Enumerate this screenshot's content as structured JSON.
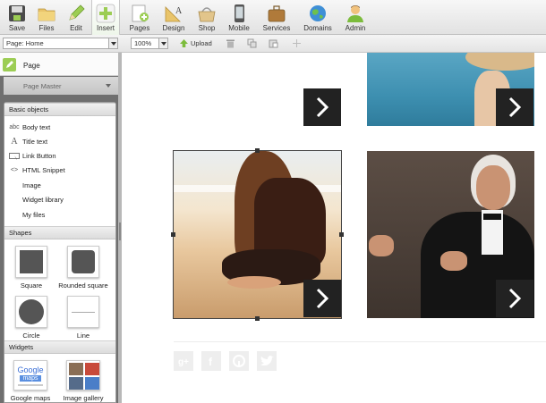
{
  "toolbar": {
    "items": [
      {
        "label": "Save",
        "icon": "save-icon"
      },
      {
        "label": "Files",
        "icon": "folder-icon"
      },
      {
        "label": "Edit",
        "icon": "pencil-icon"
      },
      {
        "label": "Insert",
        "icon": "plus-icon"
      },
      {
        "label": "Pages",
        "icon": "page-add-icon"
      },
      {
        "label": "Design",
        "icon": "design-icon"
      },
      {
        "label": "Shop",
        "icon": "basket-icon"
      },
      {
        "label": "Mobile",
        "icon": "phone-icon"
      },
      {
        "label": "Services",
        "icon": "briefcase-icon"
      },
      {
        "label": "Domains",
        "icon": "globe-icon"
      },
      {
        "label": "Admin",
        "icon": "user-icon"
      }
    ]
  },
  "subbar": {
    "page_select": "Page: Home",
    "zoom_select": "100%",
    "upload_label": "Upload"
  },
  "panel": {
    "page_label": "Page",
    "master_label": "Page Master",
    "basic_title": "Basic objects",
    "basic_items": [
      {
        "icon_text": "abc",
        "label": "Body text"
      },
      {
        "icon_text": "A",
        "label": "Title text"
      },
      {
        "icon_text": "",
        "label": "Link Button"
      },
      {
        "icon_text": "<>",
        "label": "HTML Snippet"
      },
      {
        "icon_text": "",
        "label": "Image"
      },
      {
        "icon_text": "",
        "label": "Widget library"
      },
      {
        "icon_text": "",
        "label": "My files"
      }
    ],
    "shapes_title": "Shapes",
    "shapes": [
      {
        "label": "Square"
      },
      {
        "label": "Rounded square"
      },
      {
        "label": "Circle"
      },
      {
        "label": "Line"
      }
    ],
    "widgets_title": "Widgets",
    "widgets": [
      {
        "label": "Google maps",
        "thumb_text_1": "Google",
        "thumb_text_2": "maps"
      },
      {
        "label": "Image gallery"
      }
    ]
  },
  "colors": {
    "accent_green": "#9ccd54",
    "arrow_bg": "#222222",
    "panel_bg": "#6f6f6f"
  }
}
